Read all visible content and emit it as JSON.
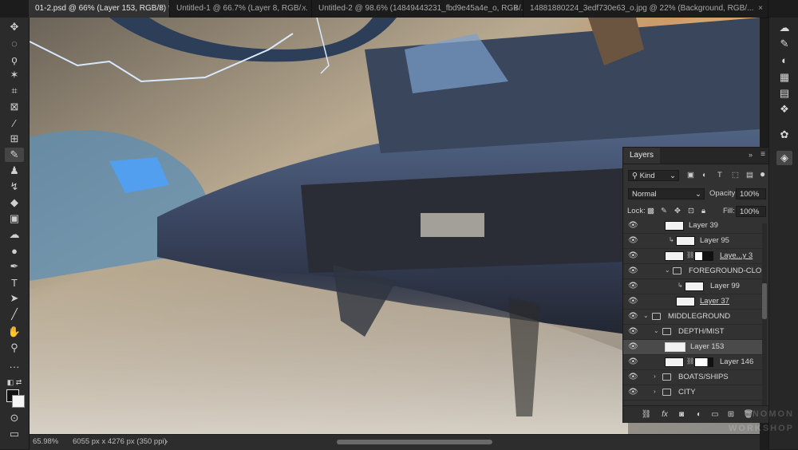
{
  "tabs": [
    {
      "label": "01-2.psd @ 66% (Layer 153, RGB/8) *",
      "active": true
    },
    {
      "label": "Untitled-1 @ 66.7% (Layer 8, RGB/...",
      "active": false
    },
    {
      "label": "Untitled-2 @ 98.6% (14849443231_fbd9e45a4e_o, RGB/...",
      "active": false
    },
    {
      "label": "14881880224_3edf730e63_o.jpg @ 22% (Background, RGB/...",
      "active": false
    }
  ],
  "tab_close": "×",
  "status": {
    "zoom": "65.98%",
    "doc_size": "6055 px x 4276 px (350 ppi)",
    "arrow": "›"
  },
  "layers_panel": {
    "tab": "Layers",
    "kind_label": "Kind",
    "blend_mode": "Normal",
    "opacity_label": "Opacity:",
    "opacity_value": "100%",
    "lock_label": "Lock:",
    "fill_label": "Fill:",
    "fill_value": "100%",
    "rows": [
      {
        "name": "Layer 39",
        "indent": 2,
        "type": "layer"
      },
      {
        "name": "Layer 95",
        "indent": 3,
        "type": "clip"
      },
      {
        "name": "Laye...y 3",
        "indent": 2,
        "type": "masked",
        "underline": true
      },
      {
        "name": "FOREGROUND-CLOUD",
        "indent": 2,
        "type": "group"
      },
      {
        "name": "Layer 99",
        "indent": 3,
        "type": "clip"
      },
      {
        "name": "Layer 37",
        "indent": 2,
        "type": "layer",
        "underline": true
      },
      {
        "name": "MIDDLEGROUND",
        "indent": 0,
        "type": "group"
      },
      {
        "name": "DEPTH/MIST",
        "indent": 1,
        "type": "group"
      },
      {
        "name": "Layer 153",
        "indent": 1,
        "type": "layer",
        "selected": true
      },
      {
        "name": "Layer 146",
        "indent": 1,
        "type": "masked"
      },
      {
        "name": "BOATS/SHIPS",
        "indent": 1,
        "type": "group"
      },
      {
        "name": "CITY",
        "indent": 1,
        "type": "group"
      }
    ],
    "footer_icons": [
      "link-icon",
      "fx-icon",
      "mask-icon",
      "adjustment-icon",
      "group-icon",
      "new-layer-icon",
      "trash-icon"
    ],
    "footer_fx": "fx"
  },
  "watermark": [
    "GNOMON",
    "WORKSHOP"
  ],
  "colors": {
    "accent": "#1473e6",
    "panel": "#323232",
    "selected_row": "#4a4a4a"
  }
}
